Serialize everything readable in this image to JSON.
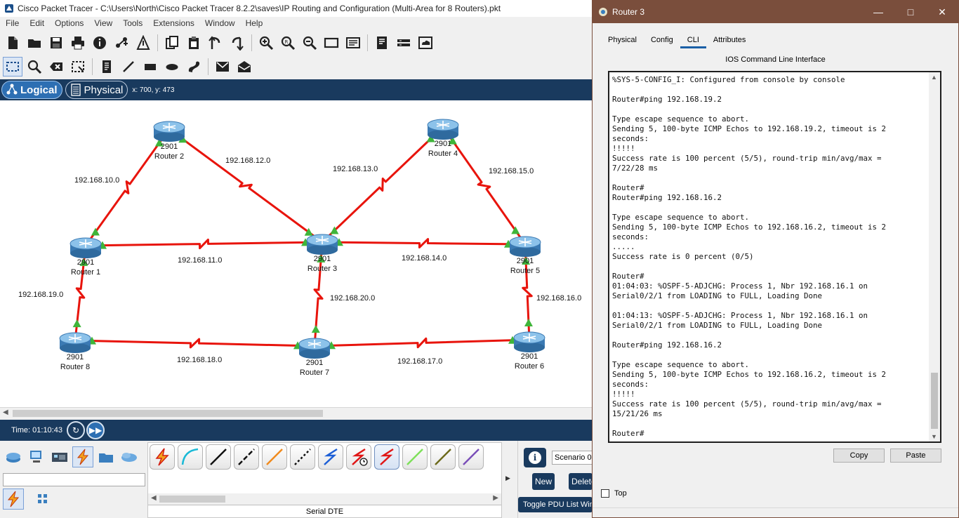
{
  "main_window": {
    "title": "Cisco Packet Tracer - C:\\Users\\North\\Cisco Packet Tracer 8.2.2\\saves\\IP Routing and Configuration (Multi-Area for 8 Routers).pkt",
    "menu": [
      "File",
      "Edit",
      "Options",
      "View",
      "Tools",
      "Extensions",
      "Window",
      "Help"
    ],
    "toolbar1_icons": [
      "new-file-icon",
      "open-folder-icon",
      "save-icon",
      "print-icon",
      "info-icon",
      "network-icon",
      "activity-wizard-icon",
      "copy-icon",
      "paste-icon",
      "undo-icon",
      "redo-icon",
      "zoom-in-icon",
      "zoom-reset-icon",
      "zoom-out-icon",
      "drawing-palette-icon",
      "custom-devices-icon",
      "viewport-icon",
      "router-dialog-icon",
      "cloud-icon"
    ],
    "toolbar2_icons": [
      "select-icon",
      "inspect-icon",
      "delete-icon",
      "resize-icon",
      "note-icon",
      "line-icon",
      "rectangle-icon",
      "ellipse-icon",
      "freeform-icon",
      "simple-pdu-icon",
      "complex-pdu-icon"
    ]
  },
  "view_bar": {
    "logical_label": "Logical",
    "physical_label": "Physical",
    "coords": "x: 700, y: 473"
  },
  "topology": {
    "routers": [
      {
        "id": "r2",
        "model": "2901",
        "name": "Router 2"
      },
      {
        "id": "r4",
        "model": "2901",
        "name": "Router 4"
      },
      {
        "id": "r1",
        "model": "2901",
        "name": "Router 1"
      },
      {
        "id": "r3",
        "model": "2901",
        "name": "Router 3"
      },
      {
        "id": "r5",
        "model": "2901",
        "name": "Router 5"
      },
      {
        "id": "r8",
        "model": "2901",
        "name": "Router 8"
      },
      {
        "id": "r7",
        "model": "2901",
        "name": "Router 7"
      },
      {
        "id": "r6",
        "model": "2901",
        "name": "Router 6"
      }
    ],
    "networks": [
      "192.168.10.0",
      "192.168.12.0",
      "192.168.13.0",
      "192.168.15.0",
      "192.168.11.0",
      "192.168.14.0",
      "192.168.19.0",
      "192.168.20.0",
      "192.168.16.0",
      "192.168.18.0",
      "192.168.17.0"
    ],
    "link_color": "#e8140c",
    "port_status_color": "#3fb53a"
  },
  "time_bar": {
    "time": "Time: 01:10:43"
  },
  "bottom_panel": {
    "device_categories": [
      "network-devices-icon",
      "end-devices-icon",
      "components-icon",
      "connections-icon",
      "miscellaneous-icon",
      "multiuser-icon"
    ],
    "device_subtypes": [
      "connections-auto-icon",
      "connections-grid-icon"
    ],
    "cables": [
      "automatic-cable",
      "console-cable",
      "copper-straight-through",
      "copper-cross-over",
      "fiber-cable",
      "phone-cable",
      "coaxial-cable",
      "serial-dce",
      "serial-dte",
      "octal-cable",
      "iot-cable",
      "usb-cable"
    ],
    "selected_cable_name": "Serial DTE",
    "scenario": "Scenario 0",
    "new_label": "New",
    "delete_label": "Delete",
    "toggle_pdu_label": "Toggle PDU List Window"
  },
  "router_window": {
    "title": "Router 3",
    "tabs": [
      "Physical",
      "Config",
      "CLI",
      "Attributes"
    ],
    "active_tab": "CLI",
    "cli_heading": "IOS Command Line Interface",
    "terminal_text": "Router#\n%SYS-5-CONFIG_I: Configured from console by console\n\nRouter#ping 192.168.19.2\n\nType escape sequence to abort.\nSending 5, 100-byte ICMP Echos to 192.168.19.2, timeout is 2\nseconds:\n!!!!!\nSuccess rate is 100 percent (5/5), round-trip min/avg/max =\n7/22/28 ms\n\nRouter#\nRouter#ping 192.168.16.2\n\nType escape sequence to abort.\nSending 5, 100-byte ICMP Echos to 192.168.16.2, timeout is 2\nseconds:\n.....\nSuccess rate is 0 percent (0/5)\n\nRouter#\n01:04:03: %OSPF-5-ADJCHG: Process 1, Nbr 192.168.16.1 on\nSerial0/2/1 from LOADING to FULL, Loading Done\n\n01:04:13: %OSPF-5-ADJCHG: Process 1, Nbr 192.168.16.1 on\nSerial0/2/1 from LOADING to FULL, Loading Done\n\nRouter#ping 192.168.16.2\n\nType escape sequence to abort.\nSending 5, 100-byte ICMP Echos to 192.168.16.2, timeout is 2\nseconds:\n!!!!!\nSuccess rate is 100 percent (5/5), round-trip min/avg/max =\n15/21/26 ms\n\nRouter#",
    "copy_label": "Copy",
    "paste_label": "Paste",
    "top_label": "Top",
    "title_bar_color": "#7a4e3c"
  }
}
